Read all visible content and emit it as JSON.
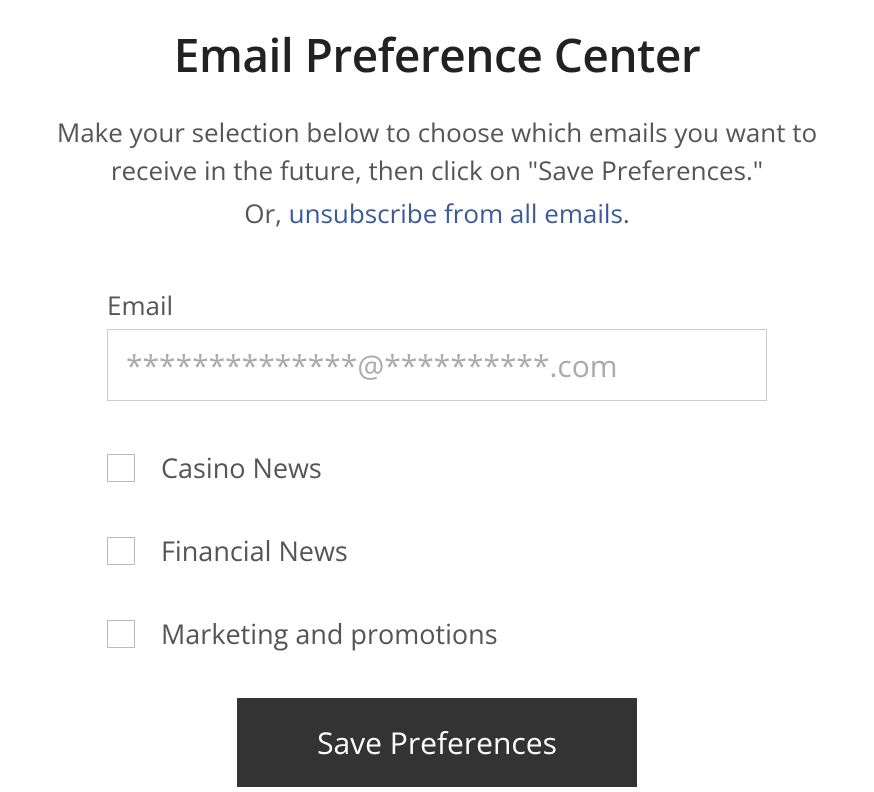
{
  "header": {
    "title": "Email Preference Center",
    "description": "Make your selection below to choose which emails you want to receive in the future, then click on \"Save Preferences.\"",
    "or_prefix": "Or, ",
    "unsubscribe_text": "unsubscribe from all emails",
    "period": "."
  },
  "form": {
    "email_label": "Email",
    "email_value": "**************@**********.com",
    "options": [
      {
        "label": "Casino News"
      },
      {
        "label": "Financial News"
      },
      {
        "label": "Marketing and promotions"
      }
    ],
    "save_button_label": "Save Preferences"
  }
}
